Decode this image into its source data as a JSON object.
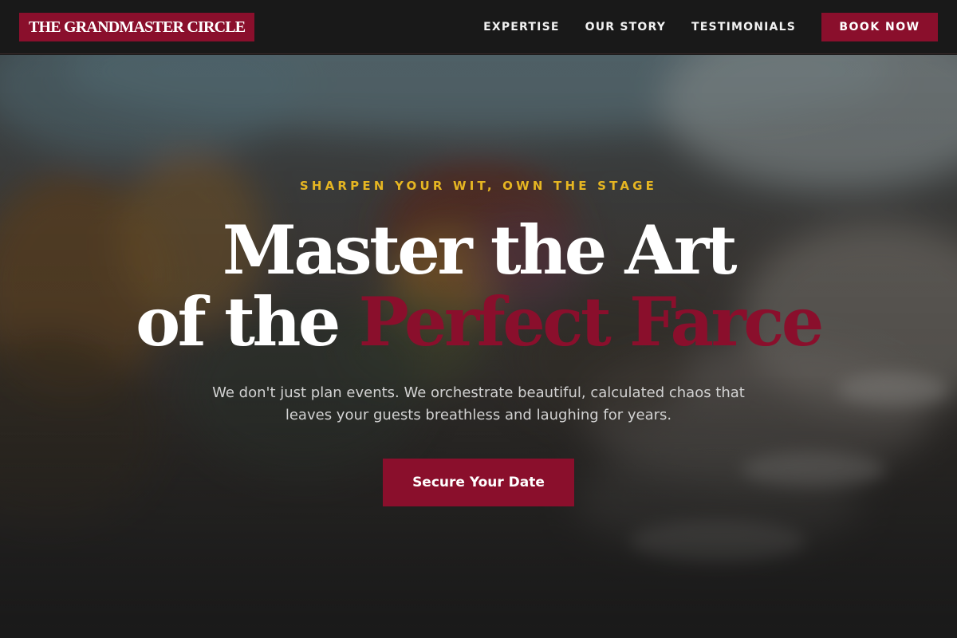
{
  "nav": {
    "brand": "THE GRANDMASTER CIRCLE",
    "links": [
      {
        "label": "EXPERTISE"
      },
      {
        "label": "OUR STORY"
      },
      {
        "label": "TESTIMONIALS"
      }
    ],
    "cta": "BOOK NOW"
  },
  "hero": {
    "eyebrow": "SHARPEN YOUR WIT, OWN THE STAGE",
    "headline_line1": "Master the Art",
    "headline_line2_prefix": "of the ",
    "headline_line2_accent": "Perfect Farce",
    "subtext": "We don't just plan events. We orchestrate beautiful, calculated chaos that leaves your guests breathless and laughing for years.",
    "cta": "Secure Your Date",
    "background_image": "blurred-banquet-table-photo"
  },
  "colors": {
    "brand_red": "#8a0f2c",
    "eyebrow_gold": "#e6b622",
    "navbar_bg": "#191919"
  }
}
